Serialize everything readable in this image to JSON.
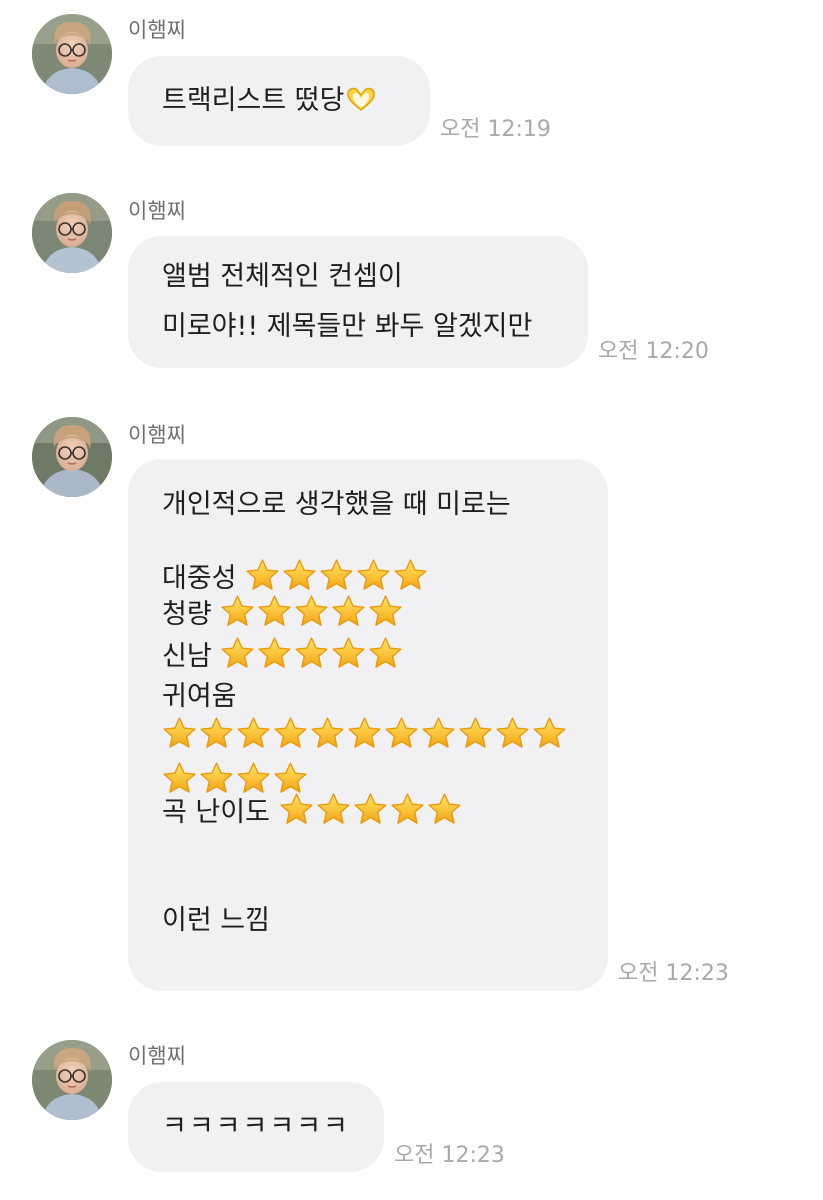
{
  "messages": [
    {
      "sender": "이햄찌",
      "lines": [
        "트랙리스트 떴당"
      ],
      "time": "오전 12:19"
    },
    {
      "sender": "이햄찌",
      "lines": [
        "앨범 전체적인 컨셉이",
        "미로야!! 제목들만 봐두 알겠지만"
      ],
      "time": "오전 12:20"
    },
    {
      "sender": "이햄찌",
      "intro": "개인적으로 생각했을 때 미로는",
      "ratings": [
        {
          "label": "대중성",
          "stars": 5
        },
        {
          "label": "청량",
          "stars": 5
        },
        {
          "label": "신남",
          "stars": 5
        },
        {
          "label": "귀여움",
          "stars": 15
        },
        {
          "label": "곡 난이도",
          "stars": 5
        }
      ],
      "outro": "이런 느낌",
      "time": "오전 12:23"
    },
    {
      "sender": "이햄찌",
      "lines": [
        "ㅋㅋㅋㅋㅋㅋㅋ"
      ],
      "time": "오전 12:23"
    }
  ],
  "icons": {
    "heart": "heart-hands-emoji",
    "star": "star-emoji"
  },
  "colors": {
    "bubble": "#f1f1f4",
    "time": "#a9a9ad",
    "sender": "#6f6f72"
  }
}
